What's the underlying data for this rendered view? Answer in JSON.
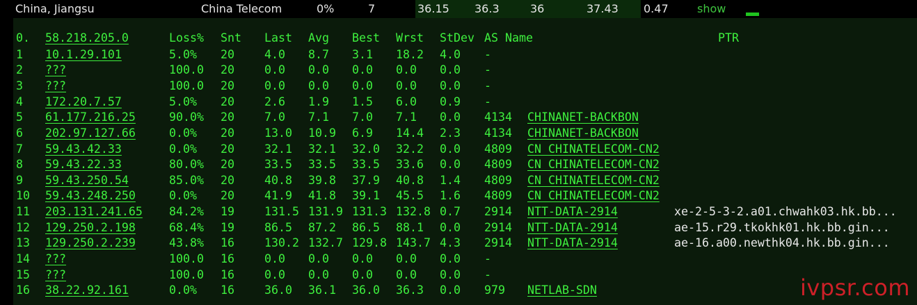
{
  "header": {
    "location": "China, Jiangsu",
    "isp": "China Telecom",
    "loss": "0%",
    "sent": "7",
    "last": "36.15",
    "avg": "36.3",
    "best": "36",
    "worst": "37.43",
    "stdev": "0.47",
    "action": "show"
  },
  "columns": {
    "loss": "Loss%",
    "snt": "Snt",
    "last": "Last",
    "avg": "Avg",
    "best": "Best",
    "wrst": "Wrst",
    "stdev": "StDev",
    "asname": "AS Name",
    "ptr": "PTR"
  },
  "origin": {
    "hop": "0.",
    "ip": "58.218.205.0"
  },
  "hops": [
    {
      "hop": "1",
      "ip": "10.1.29.101",
      "loss": "5.0%",
      "snt": "20",
      "last": "4.0",
      "avg": "8.7",
      "best": "3.1",
      "wrst": "18.2",
      "stdev": "4.0",
      "as": "-",
      "asname": "",
      "ptr": ""
    },
    {
      "hop": "2",
      "ip": "???",
      "loss": "100.0",
      "snt": "20",
      "last": "0.0",
      "avg": "0.0",
      "best": "0.0",
      "wrst": "0.0",
      "stdev": "0.0",
      "as": "-",
      "asname": "",
      "ptr": ""
    },
    {
      "hop": "3",
      "ip": "???",
      "loss": "100.0",
      "snt": "20",
      "last": "0.0",
      "avg": "0.0",
      "best": "0.0",
      "wrst": "0.0",
      "stdev": "0.0",
      "as": "-",
      "asname": "",
      "ptr": ""
    },
    {
      "hop": "4",
      "ip": "172.20.7.57",
      "loss": "5.0%",
      "snt": "20",
      "last": "2.6",
      "avg": "1.9",
      "best": "1.5",
      "wrst": "6.0",
      "stdev": "0.9",
      "as": "-",
      "asname": "",
      "ptr": ""
    },
    {
      "hop": "5",
      "ip": "61.177.216.25",
      "loss": "90.0%",
      "snt": "20",
      "last": "7.0",
      "avg": "7.1",
      "best": "7.0",
      "wrst": "7.1",
      "stdev": "0.0",
      "as": "4134",
      "asname": "CHINANET-BACKBON",
      "ptr": ""
    },
    {
      "hop": "6",
      "ip": "202.97.127.66",
      "loss": "0.0%",
      "snt": "20",
      "last": "13.0",
      "avg": "10.9",
      "best": "6.9",
      "wrst": "14.4",
      "stdev": "2.3",
      "as": "4134",
      "asname": "CHINANET-BACKBON",
      "ptr": ""
    },
    {
      "hop": "7",
      "ip": "59.43.42.33",
      "loss": "0.0%",
      "snt": "20",
      "last": "32.1",
      "avg": "32.1",
      "best": "32.0",
      "wrst": "32.2",
      "stdev": "0.0",
      "as": "4809",
      "asname": "CN CHINATELECOM-CN2",
      "ptr": ""
    },
    {
      "hop": "8",
      "ip": "59.43.22.33",
      "loss": "80.0%",
      "snt": "20",
      "last": "33.5",
      "avg": "33.5",
      "best": "33.5",
      "wrst": "33.6",
      "stdev": "0.0",
      "as": "4809",
      "asname": "CN CHINATELECOM-CN2",
      "ptr": ""
    },
    {
      "hop": "9",
      "ip": "59.43.250.54",
      "loss": "85.0%",
      "snt": "20",
      "last": "40.8",
      "avg": "39.8",
      "best": "37.9",
      "wrst": "40.8",
      "stdev": "1.4",
      "as": "4809",
      "asname": "CN CHINATELECOM-CN2",
      "ptr": ""
    },
    {
      "hop": "10",
      "ip": "59.43.248.250",
      "loss": "0.0%",
      "snt": "20",
      "last": "41.9",
      "avg": "41.8",
      "best": "39.1",
      "wrst": "45.5",
      "stdev": "1.6",
      "as": "4809",
      "asname": "CN CHINATELECOM-CN2",
      "ptr": ""
    },
    {
      "hop": "11",
      "ip": "203.131.241.65",
      "loss": "84.2%",
      "snt": "19",
      "last": "131.5",
      "avg": "131.9",
      "best": "131.3",
      "wrst": "132.8",
      "stdev": "0.7",
      "as": "2914",
      "asname": "NTT-DATA-2914",
      "ptr": "xe-2-5-3-2.a01.chwahk03.hk.bb..."
    },
    {
      "hop": "12",
      "ip": "129.250.2.198",
      "loss": "68.4%",
      "snt": "19",
      "last": "86.5",
      "avg": "87.2",
      "best": "86.5",
      "wrst": "88.1",
      "stdev": "0.0",
      "as": "2914",
      "asname": "NTT-DATA-2914",
      "ptr": "ae-15.r29.tkokhk01.hk.bb.gin..."
    },
    {
      "hop": "13",
      "ip": "129.250.2.239",
      "loss": "43.8%",
      "snt": "16",
      "last": "130.2",
      "avg": "132.7",
      "best": "129.8",
      "wrst": "143.7",
      "stdev": "4.3",
      "as": "2914",
      "asname": "NTT-DATA-2914",
      "ptr": "ae-16.a00.newthk04.hk.bb.gin..."
    },
    {
      "hop": "14",
      "ip": "???",
      "loss": "100.0",
      "snt": "16",
      "last": "0.0",
      "avg": "0.0",
      "best": "0.0",
      "wrst": "0.0",
      "stdev": "0.0",
      "as": "-",
      "asname": "",
      "ptr": ""
    },
    {
      "hop": "15",
      "ip": "???",
      "loss": "100.0",
      "snt": "16",
      "last": "0.0",
      "avg": "0.0",
      "best": "0.0",
      "wrst": "0.0",
      "stdev": "0.0",
      "as": "-",
      "asname": "",
      "ptr": ""
    },
    {
      "hop": "16",
      "ip": "38.22.92.161",
      "loss": "0.0%",
      "snt": "16",
      "last": "36.0",
      "avg": "36.1",
      "best": "36.0",
      "wrst": "36.3",
      "stdev": "0.0",
      "as": "979",
      "asname": "NETLAB-SDN",
      "ptr": ""
    }
  ],
  "watermark": "ivpsr.com",
  "colors": {
    "terminal_text": "#3ef03e",
    "panel_bg": "#0b1b0b",
    "header_highlight": "#0b2a0b",
    "watermark": "#d8212a"
  }
}
